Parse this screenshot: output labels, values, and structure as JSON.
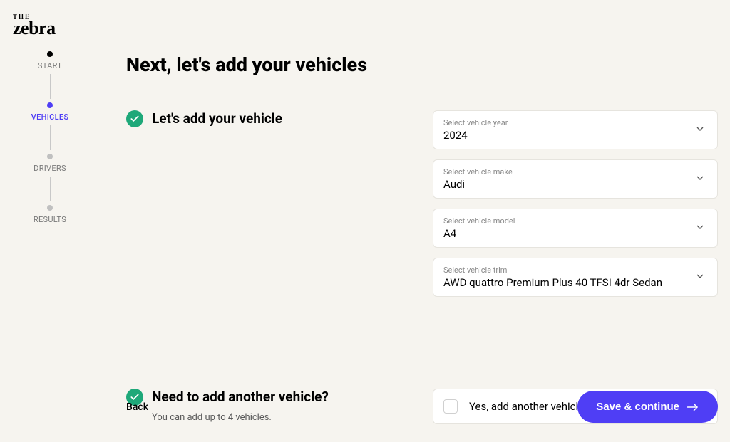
{
  "logo": {
    "prefix": "THE",
    "name": "zebra"
  },
  "stepper": {
    "steps": [
      {
        "label": "START",
        "state": "done"
      },
      {
        "label": "VEHICLES",
        "state": "active"
      },
      {
        "label": "DRIVERS",
        "state": "pending"
      },
      {
        "label": "RESULTS",
        "state": "pending"
      }
    ]
  },
  "page": {
    "title": "Next, let's add your vehicles"
  },
  "section_vehicle": {
    "title": "Let's add your vehicle",
    "fields": {
      "year": {
        "label": "Select vehicle year",
        "value": "2024"
      },
      "make": {
        "label": "Select vehicle make",
        "value": "Audi"
      },
      "model": {
        "label": "Select vehicle model",
        "value": "A4"
      },
      "trim": {
        "label": "Select vehicle trim",
        "value": "AWD quattro Premium Plus 40 TFSI 4dr Sedan"
      }
    }
  },
  "section_another": {
    "title": "Need to add another vehicle?",
    "subtitle": "You can add up to 4 vehicles.",
    "checkbox_label": "Yes, add another vehicle."
  },
  "footer": {
    "back": "Back",
    "continue": "Save & continue"
  },
  "colors": {
    "accent": "#4f3ef5",
    "success": "#1ea879",
    "bg": "#f6f4ef"
  }
}
